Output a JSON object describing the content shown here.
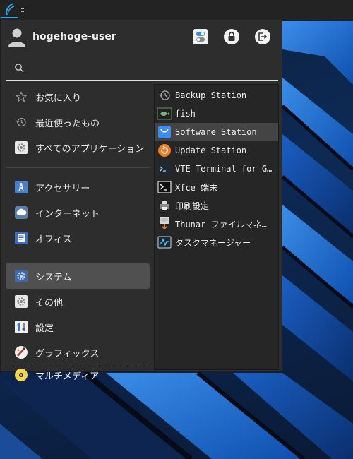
{
  "user": {
    "name": "hogehoge-user"
  },
  "search": {
    "placeholder": "",
    "value": ""
  },
  "header_buttons": [
    {
      "name": "settings",
      "icon": "toggles-icon"
    },
    {
      "name": "lock",
      "icon": "lock-icon"
    },
    {
      "name": "logout",
      "icon": "logout-icon"
    }
  ],
  "categories": [
    {
      "label": "お気に入り",
      "icon": "star-icon"
    },
    {
      "label": "最近使ったもの",
      "icon": "history-icon"
    },
    {
      "label": "すべてのアプリケーション",
      "icon": "gear-icon"
    },
    {
      "label": "アクセサリー",
      "icon": "accessories-icon"
    },
    {
      "label": "インターネット",
      "icon": "cloud-icon"
    },
    {
      "label": "オフィス",
      "icon": "document-icon"
    },
    {
      "label": "システム",
      "icon": "gear-icon",
      "selected": true
    },
    {
      "label": "その他",
      "icon": "gear-icon"
    },
    {
      "label": "設定",
      "icon": "settings-icon"
    },
    {
      "label": "グラフィックス",
      "icon": "palette-icon"
    },
    {
      "label": "マルチメディア",
      "icon": "disc-icon"
    }
  ],
  "apps": [
    {
      "label": "Backup Station",
      "icon": "history-icon"
    },
    {
      "label": "fish",
      "icon": "fish-terminal-icon"
    },
    {
      "label": "Software Station",
      "icon": "shopping-bag-icon",
      "selected": true
    },
    {
      "label": "Update Station",
      "icon": "update-icon"
    },
    {
      "label": "VTE Terminal for G…",
      "icon": "terminal-icon"
    },
    {
      "label": "Xfce 端末",
      "icon": "terminal-icon"
    },
    {
      "label": "印刷設定",
      "icon": "printer-icon"
    },
    {
      "label": "Thunar ファイルマネ…",
      "icon": "file-manager-icon"
    },
    {
      "label": "タスクマネージャー",
      "icon": "task-manager-icon"
    }
  ],
  "colors": {
    "accent": "#2fa7e6",
    "menu_bg": "#2d2d2d",
    "selection": "#505050",
    "software_station": "#3d8cf0",
    "update_station": "#f07c1e",
    "multimedia": "#f2d64b"
  }
}
